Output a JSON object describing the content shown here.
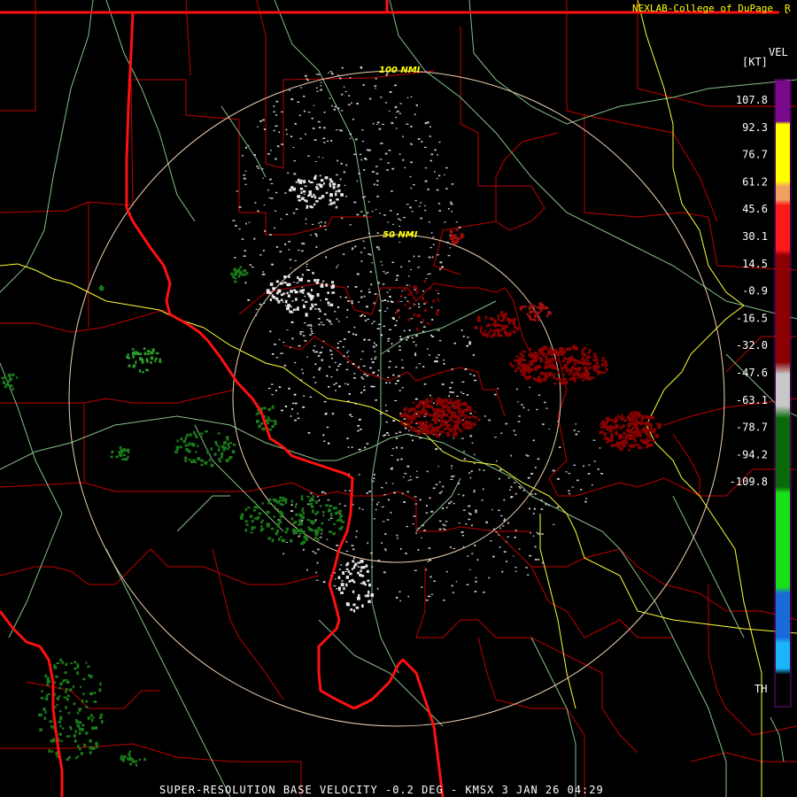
{
  "credit": "NEXLAB-College of DuPage",
  "logo_mark": "Ɽ",
  "footer": "SUPER-RESOLUTION BASE VELOCITY -0.2 DEG - KMSX 3 JAN 26 04:29",
  "range_rings": {
    "inner": "50 NMI",
    "outer": "100 NMI"
  },
  "legend": {
    "title": "VEL",
    "unit": "[KT]",
    "values": [
      "107.8",
      "92.3",
      "76.7",
      "61.2",
      "45.6",
      "30.1",
      "14.5",
      "-0.9",
      "-16.5",
      "-32.0",
      "-47.6",
      "-63.1",
      "-78.7",
      "-94.2",
      "-109.8"
    ],
    "bottom_label": "TH",
    "colors": {
      "purple": "#7a0a8c",
      "yellow": "#ffff00",
      "orange": "#f0a060",
      "red": "#ff1a1a",
      "dark_red": "#8b0000",
      "gray": "#c8c8c8",
      "dark_green": "#0a6a0a",
      "green": "#18e018",
      "blue": "#1a6ad8",
      "cyan": "#1ab6f8",
      "background": "#000000"
    }
  },
  "map_colors": {
    "state_border": "#ff0000",
    "county_border": "#c00000",
    "highway": "#ffff33",
    "river": "#86c086",
    "range_ring": "#f0d0b0"
  }
}
